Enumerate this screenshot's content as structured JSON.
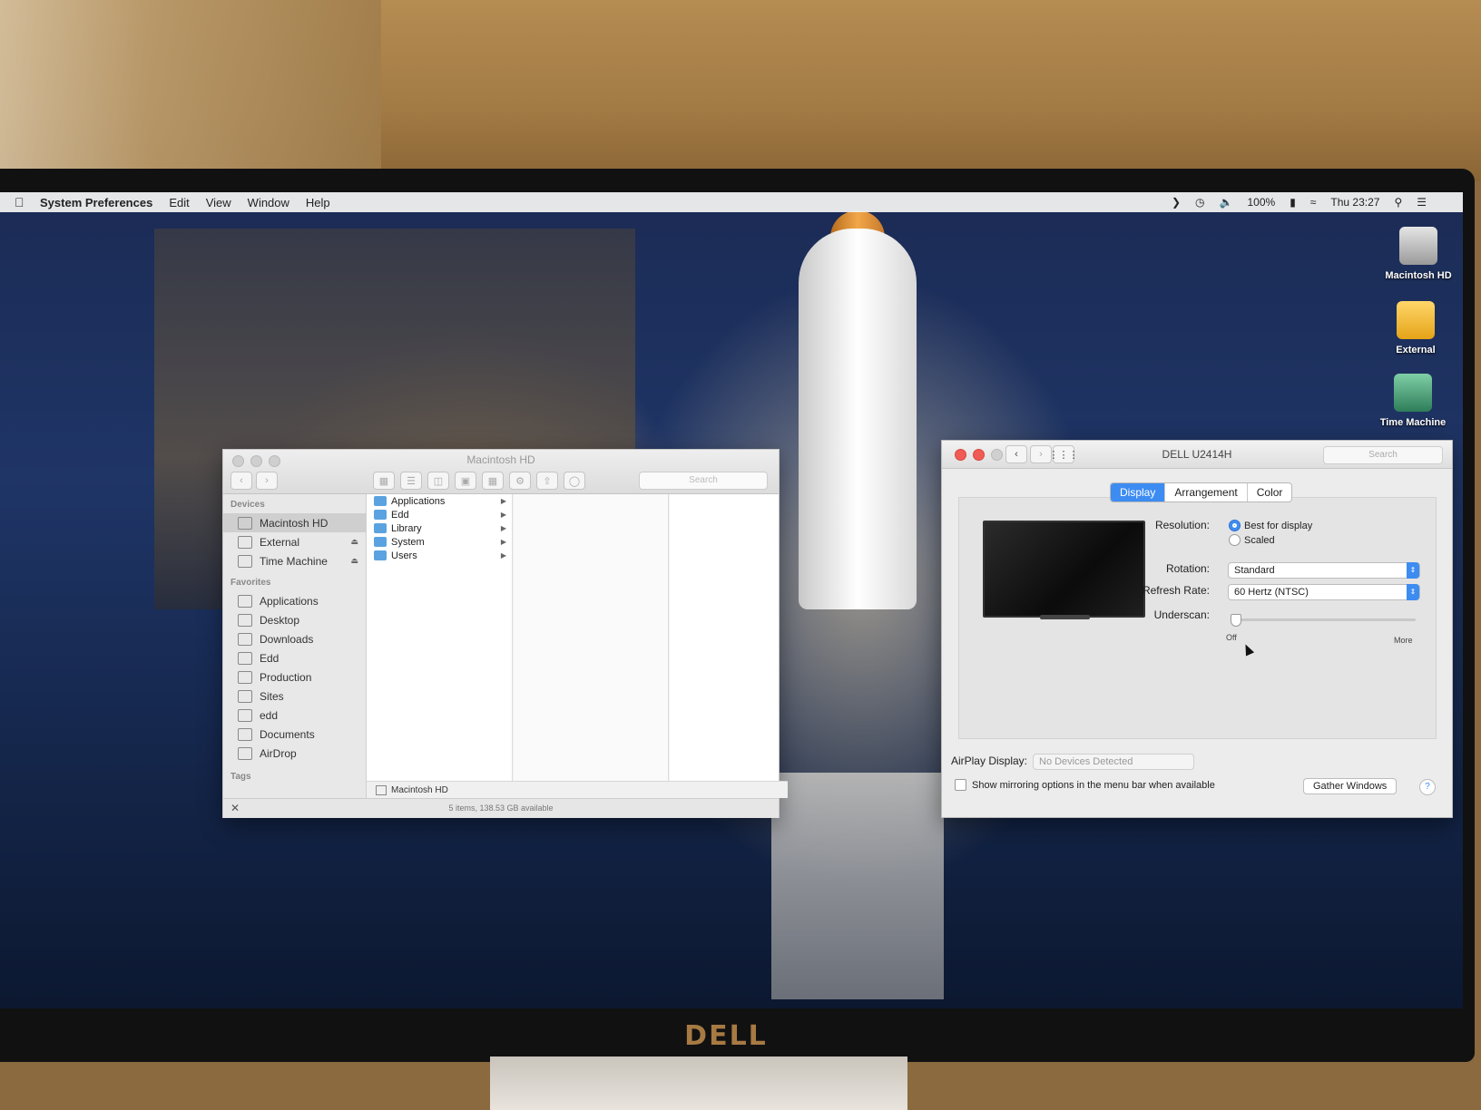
{
  "menubar": {
    "app": "System Preferences",
    "menus": [
      "Edit",
      "View",
      "Window",
      "Help"
    ],
    "battery": "100%",
    "clock": "Thu 23:27"
  },
  "desktop_icons": [
    {
      "label": "Macintosh HD"
    },
    {
      "label": "External"
    },
    {
      "label": "Time Machine"
    }
  ],
  "finder": {
    "title": "Macintosh HD",
    "search_placeholder": "Search",
    "sidebar": {
      "devices_header": "Devices",
      "devices": [
        "Macintosh HD",
        "External",
        "Time Machine"
      ],
      "favorites_header": "Favorites",
      "favorites": [
        "Applications",
        "Desktop",
        "Downloads",
        "Edd",
        "Production",
        "Sites",
        "edd",
        "Documents",
        "AirDrop"
      ],
      "tags_header": "Tags"
    },
    "items": [
      "Applications",
      "Edd",
      "Library",
      "System",
      "Users"
    ],
    "pathbar": "Macintosh HD",
    "status": "5 items, 138.53 GB available"
  },
  "prefs": {
    "title": "DELL U2414H",
    "search_placeholder": "Search",
    "tabs": [
      "Display",
      "Arrangement",
      "Color"
    ],
    "resolution_label": "Resolution:",
    "resolution_options": [
      "Best for display",
      "Scaled"
    ],
    "rotation_label": "Rotation:",
    "rotation_value": "Standard",
    "refresh_label": "Refresh Rate:",
    "refresh_value": "60 Hertz (NTSC)",
    "underscan_label": "Underscan:",
    "underscan_min": "Off",
    "underscan_max": "More",
    "underscan_level": 0,
    "airplay_label": "AirPlay Display:",
    "airplay_value": "No Devices Detected",
    "mirroring_label": "Show mirroring options in the menu bar when available",
    "gather_button": "Gather Windows",
    "help_button": "?"
  },
  "monitor_brand": "DELL"
}
